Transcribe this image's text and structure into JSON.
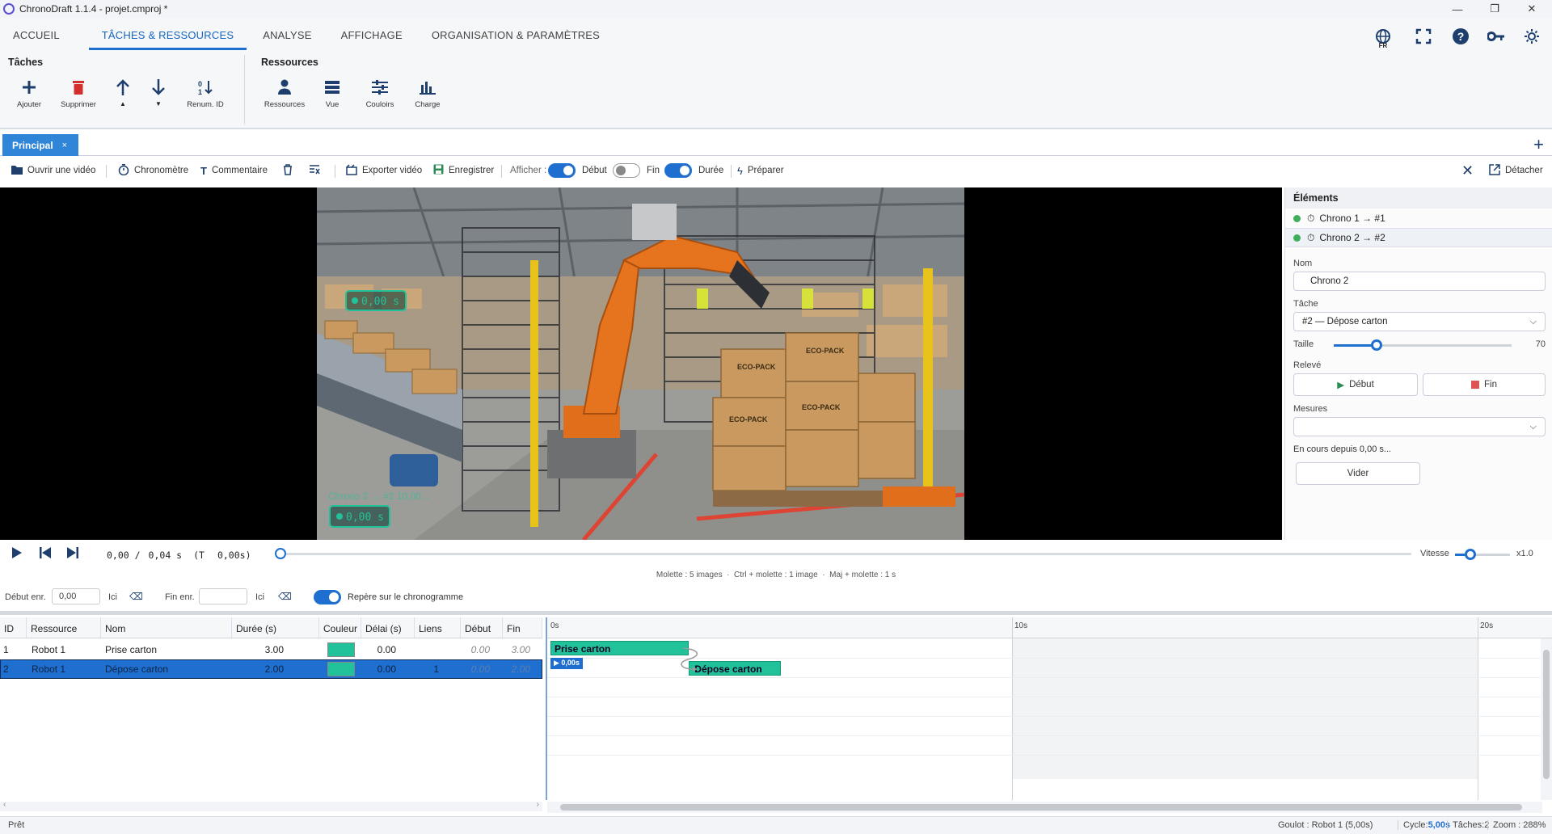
{
  "window": {
    "title": "ChronoDraft 1.1.4 - projet.cmproj *",
    "controls": [
      "—",
      "❐",
      "✕"
    ]
  },
  "ribbon_tabs": [
    "ACCUEIL",
    "TÂCHES & RESSOURCES",
    "ANALYSE",
    "AFFICHAGE",
    "ORGANISATION & PARAMÈTRES"
  ],
  "topright": {
    "lang": "FR"
  },
  "ribbon": {
    "taches_title": "Tâches",
    "ressources_title": "Ressources",
    "taches_buttons": [
      "Ajouter",
      "Supprimer",
      "",
      "",
      "Renum. ID"
    ],
    "ressources_buttons": [
      "Ressources",
      "Vue",
      "Couloirs",
      "Charge"
    ]
  },
  "doc_tab": {
    "label": "Principal",
    "close": "×"
  },
  "video_toolbar": {
    "open_video": "Ouvrir une vidéo",
    "chronometre": "Chronomètre",
    "commentaire": "Commentaire",
    "exporter": "Exporter vidéo",
    "enregistrer": "Enregistrer",
    "afficher": "Afficher :",
    "debut": "Début",
    "fin": "Fin",
    "duree": "Durée",
    "preparer": "Préparer",
    "detacher": "Détacher",
    "toggles": {
      "debut": true,
      "fin": false,
      "duree": true
    }
  },
  "video_overlays": {
    "chrono1_value": "0,00 s",
    "chrono2_label": "Chrono 2 → #2 10,00...",
    "chrono2_value": "0,00 s",
    "box_labels": [
      "ECO-PACK",
      "ECO-PACK",
      "ECO-PACK",
      "ECO-PACK"
    ]
  },
  "side_panel": {
    "header": "Éléments",
    "elements": [
      "Chrono 1 → #1",
      "Chrono 2 → #2"
    ],
    "nom_label": "Nom",
    "nom_value": "Chrono 2",
    "tache_label": "Tâche",
    "tache_value": "#2 — Dépose carton",
    "taille_label": "Taille",
    "taille_value": "70",
    "taille_fraction": 0.24,
    "releve_label": "Relevé",
    "debut_btn": "Début",
    "fin_btn": "Fin",
    "mesures_label": "Mesures",
    "en_cours": "En cours depuis 0,00 s...",
    "vider_btn": "Vider"
  },
  "player": {
    "time_current": "0,00 /",
    "time_total": "0,04 s",
    "time_t": "(T",
    "time_t_value": "0,00s)",
    "vitesse_label": "Vitesse",
    "vitesse_value": "x1.0",
    "hint": "Molette : 5 images  ·  Ctrl + molette : 1 image  ·  Maj + molette : 1 s"
  },
  "recbar": {
    "debut_label": "Début enr.",
    "debut_value": "0,00",
    "ici1": "Ici",
    "fin_label": "Fin enr.",
    "ici2": "Ici",
    "repere": "Repère sur le chronogramme"
  },
  "table": {
    "columns": [
      "ID",
      "Ressource",
      "Nom",
      "Durée (s)",
      "Couleur",
      "Délai (s)",
      "Liens",
      "Début",
      "Fin"
    ],
    "rows": [
      {
        "id": "1",
        "ressource": "Robot 1",
        "nom": "Prise carton",
        "duree": "3.00",
        "delai": "0.00",
        "liens": "",
        "debut": "0.00",
        "fin": "3.00",
        "selected": false
      },
      {
        "id": "2",
        "ressource": "Robot 1",
        "nom": "Dépose carton",
        "duree": "2.00",
        "delai": "0.00",
        "liens": "1",
        "debut": "0.00",
        "fin": "2.00",
        "selected": true
      }
    ]
  },
  "gantt": {
    "ticks": [
      "0s",
      "10s",
      "20s"
    ],
    "bars": [
      {
        "label": "Prise carton",
        "start": 0,
        "end": 3
      },
      {
        "label": "Dépose carton",
        "start": 3,
        "end": 5
      }
    ],
    "marker": "▶ 0,00s"
  },
  "status": {
    "left": "Prêt",
    "goulot": "Goulot : Robot 1 (5,00s)",
    "cycle_label": "Cycle:",
    "cycle_value": "5,00s",
    "taches": "Tâches:2",
    "zoom": "Zoom : 288%"
  },
  "colors": {
    "accent": "#1e6fd0",
    "task": "#21c29a",
    "nav": "#1e3f6e"
  }
}
